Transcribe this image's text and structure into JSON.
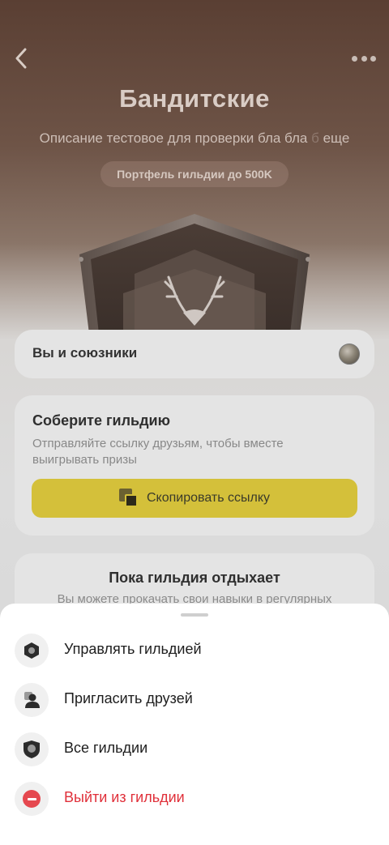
{
  "header": {
    "title": "Бандитские",
    "description_main": "Описание тестовое для проверки бла бла ",
    "description_fade": "б",
    "description_tail": " еще",
    "badge": "Портфель гильдии до 500K",
    "back_icon": "chevron-left-icon",
    "more_icon": "more-dots-icon"
  },
  "allies_card": {
    "label": "Вы и союзники"
  },
  "gather_card": {
    "title": "Соберите гильдию",
    "text": "Отправляйте ссылку друзьям, чтобы вместе выигрывать призы",
    "button_label": "Скопировать ссылку",
    "button_icon": "copy-icon",
    "accent": "#d4c03a"
  },
  "rest_card": {
    "title": "Пока гильдия отдыхает",
    "text": "Вы можете прокачать свои навыки в регулярных"
  },
  "sheet": {
    "items": [
      {
        "label": "Управлять гильдией",
        "icon": "hexagon-settings-icon"
      },
      {
        "label": "Пригласить друзей",
        "icon": "person-icon"
      },
      {
        "label": "Все гильдии",
        "icon": "shield-icon"
      },
      {
        "label": "Выйти из гильдии",
        "icon": "minus-circle-icon",
        "color": "#e0303a"
      }
    ]
  }
}
